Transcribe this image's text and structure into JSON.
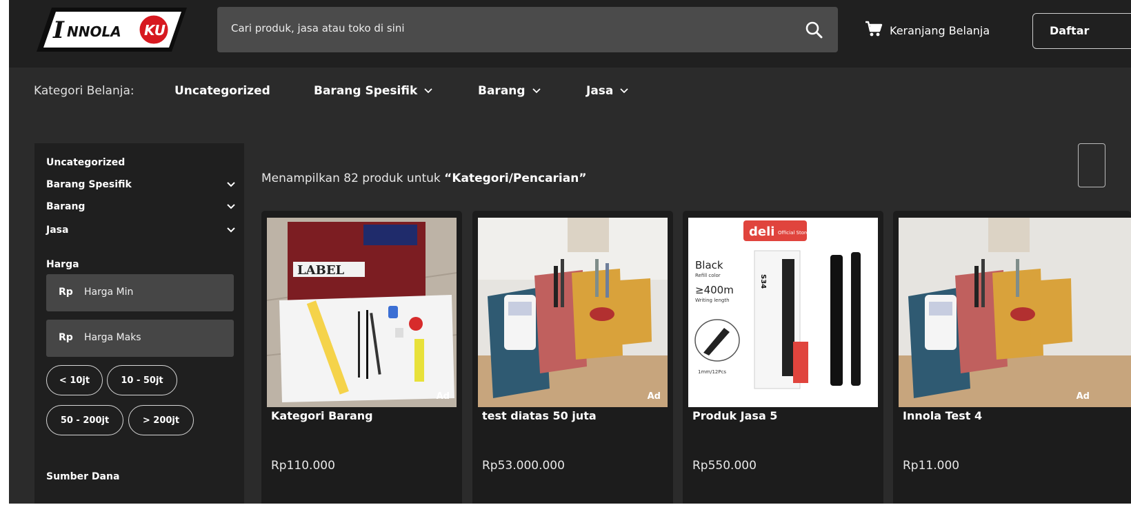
{
  "header": {
    "logo_text": "INNOLA KU",
    "search_placeholder": "Cari produk, jasa atau toko di sini",
    "cart_label": "Keranjang Belanja",
    "daftar_label": "Daftar"
  },
  "categories_bar": {
    "lead": "Kategori Belanja:",
    "links": [
      "Uncategorized",
      "Barang Spesifik",
      "Barang",
      "Jasa"
    ]
  },
  "sidebar": {
    "items": [
      "Uncategorized",
      "Barang Spesifik",
      "Barang",
      "Jasa"
    ],
    "price_heading": "Harga",
    "currency": "Rp",
    "min_placeholder": "Harga Min",
    "max_placeholder": "Harga Maks",
    "ranges": [
      "< 10jt",
      "10 - 50jt",
      "50 - 200jt",
      "> 200jt"
    ],
    "funding_heading": "Sumber Dana"
  },
  "results": {
    "prefix": "Menampilkan 82 produk untuk ",
    "query": "“Kategori/Pencarian”"
  },
  "products": [
    {
      "name": "Kategori Barang",
      "price": "Rp110.000",
      "badge": "Ad"
    },
    {
      "name": "test diatas 50 juta",
      "price": "Rp53.000.000",
      "badge": "Ad"
    },
    {
      "name": "Produk Jasa 5",
      "price": "Rp550.000",
      "badge": ""
    },
    {
      "name": "Innola Test 4",
      "price": "Rp11.000",
      "badge": "Ad"
    }
  ],
  "product_images": {
    "deli_brand": "deli",
    "deli_store": "Official Store",
    "deli_color": "Black",
    "deli_refill": "Refill color",
    "deli_length": "≥400m",
    "deli_writing": "Writing length",
    "deli_spec": "1mm/12Pcs",
    "deli_model": "S34",
    "label_book": "LABEL"
  },
  "colors": {
    "page_bg": "#2b2b2b",
    "header_bg": "#202020",
    "logo_red": "#d71920"
  }
}
